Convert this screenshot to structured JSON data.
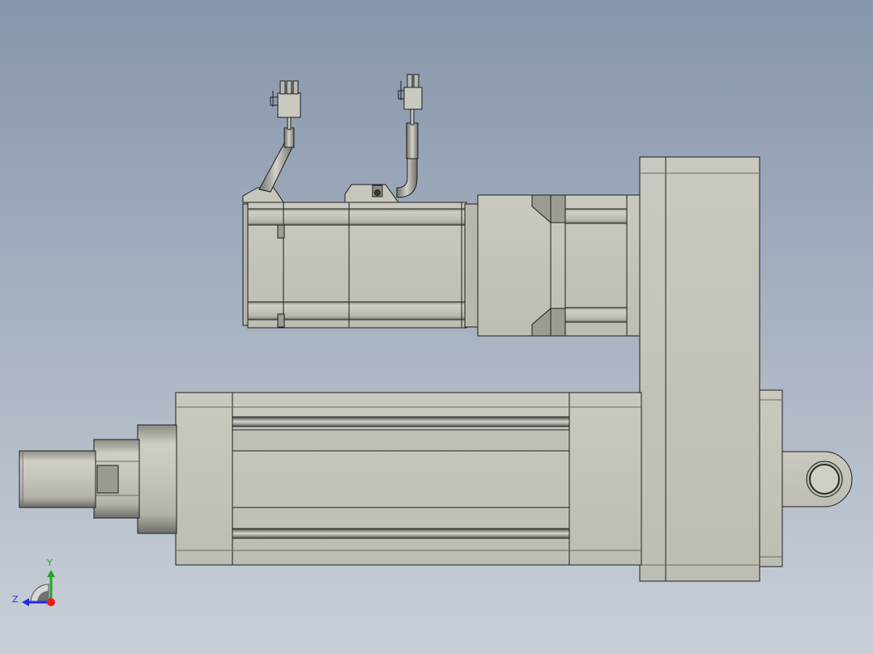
{
  "viewport": {
    "background_top": "#8796ac",
    "background_bottom": "#c9cfd8"
  },
  "model": {
    "body_color": "#c2c2b8",
    "shadow_color": "#8f8f86",
    "edge_color": "#1e1e1e",
    "components": [
      "servo-motor",
      "encoder-cable",
      "power-cable",
      "connector",
      "gear-reducer",
      "belt-housing",
      "actuator-cylinder",
      "push-rod",
      "rear-clevis"
    ]
  },
  "triad": {
    "y_label": "Y",
    "z_label": "Z",
    "x_color": "#e81c1c",
    "y_color": "#1ea81e",
    "z_color": "#1c2de8"
  }
}
